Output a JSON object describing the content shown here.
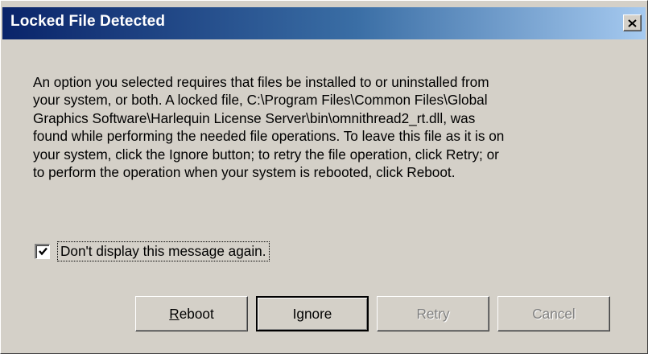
{
  "window": {
    "title": "Locked File Detected",
    "close_icon": "close-icon",
    "colors": {
      "title_start": "#0a246a",
      "title_end": "#a6caf0",
      "face": "#d4d0c8"
    }
  },
  "message": {
    "lines": [
      "An option you selected requires that files be installed to or uninstalled from",
      "your system, or both. A locked file, C:\\Program Files\\Common Files\\Global",
      "Graphics Software\\Harlequin License Server\\bin\\omnithread2_rt.dll, was",
      "found while performing the needed file operations. To leave this file as it is on",
      "your system, click the Ignore button; to retry the file operation, click Retry; or",
      "to perform the operation when your system is rebooted, click Reboot."
    ]
  },
  "checkbox": {
    "label": "Don't display this message again.",
    "checked": true
  },
  "buttons": {
    "reboot": {
      "mnemonic": "R",
      "rest": "eboot"
    },
    "ignore": {
      "label": "Ignore"
    },
    "retry": {
      "label": "Retry"
    },
    "cancel": {
      "label": "Cancel"
    }
  }
}
